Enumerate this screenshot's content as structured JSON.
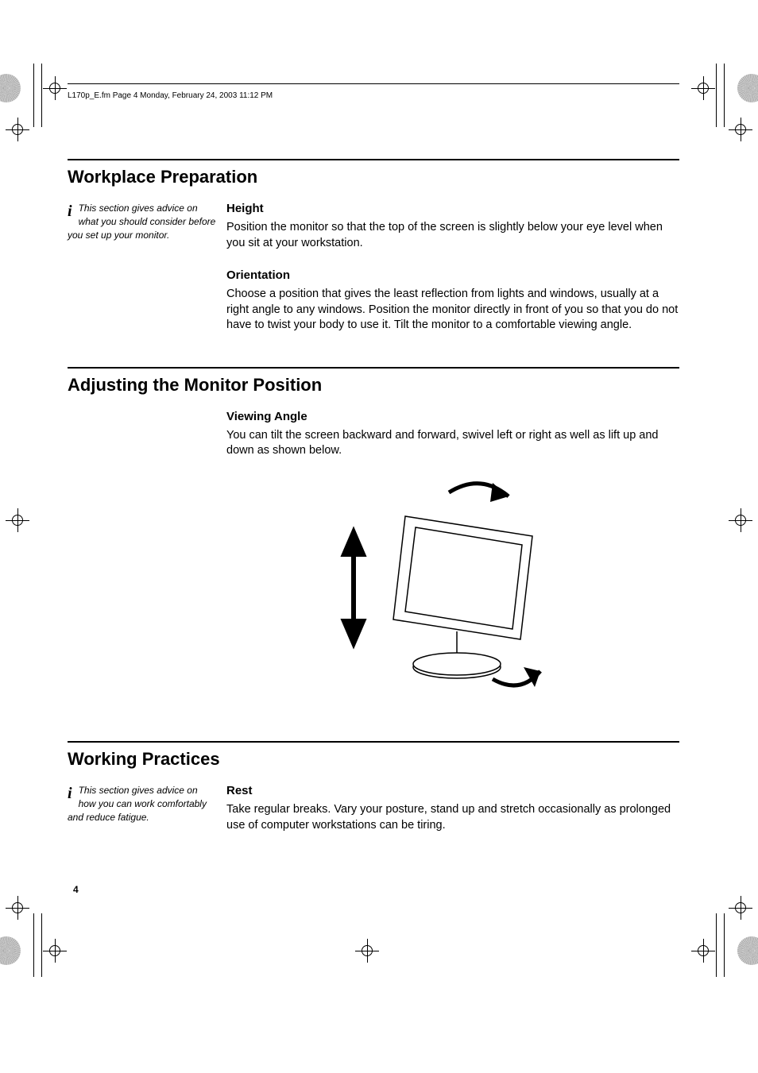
{
  "header": {
    "running_head": "L170p_E.fm  Page 4  Monday, February 24, 2003  11:12 PM"
  },
  "sections": {
    "workplace": {
      "title": "Workplace Preparation",
      "sidebar": "This section gives advice on what you should consider before you set up your monitor.",
      "sub1": {
        "heading": "Height",
        "body": "Position the monitor so that the top of the screen is slightly below your eye level when you sit at your workstation."
      },
      "sub2": {
        "heading": "Orientation",
        "body": "Choose a position that gives the least reflection from lights and windows, usually at a right angle to any windows. Position the monitor directly in front of you so that you do not have to twist your body to use it. Tilt the monitor to a comfortable viewing angle."
      }
    },
    "adjusting": {
      "title": "Adjusting the Monitor Position",
      "sub1": {
        "heading": "Viewing Angle",
        "body": "You can tilt the screen backward and forward, swivel left or right as well as lift up and down as shown below."
      }
    },
    "working": {
      "title": "Working Practices",
      "sidebar": "This section gives advice on how you can work comfortably and reduce fatigue.",
      "sub1": {
        "heading": "Rest",
        "body": "Take regular breaks. Vary your posture, stand up and stretch occasionally as prolonged use of computer workstations can be tiring."
      }
    }
  },
  "page_number": "4"
}
